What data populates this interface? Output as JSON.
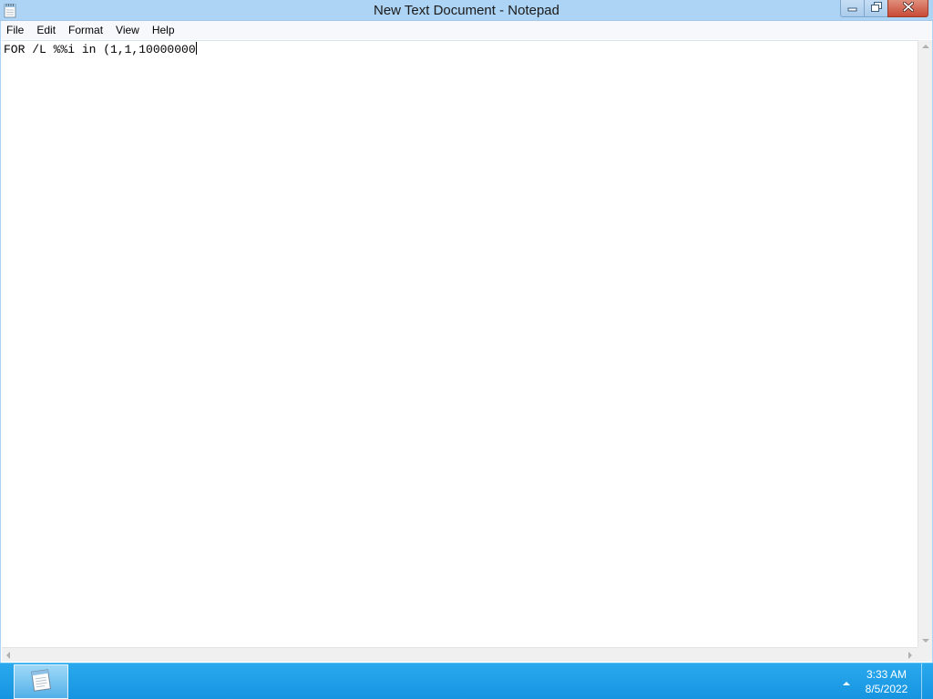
{
  "window": {
    "title": "New Text Document - Notepad",
    "icon": "notepad-icon",
    "controls": {
      "minimize_icon": "minimize-icon",
      "restore_icon": "restore-icon",
      "close_icon": "close-icon",
      "close_color": "#c74a35"
    }
  },
  "menu": {
    "items": [
      {
        "label": "File"
      },
      {
        "label": "Edit"
      },
      {
        "label": "Format"
      },
      {
        "label": "View"
      },
      {
        "label": "Help"
      }
    ]
  },
  "editor": {
    "content": "FOR /L %%i in (1,1,10000000"
  },
  "taskbar": {
    "app_icon": "notepad-icon",
    "tray_icon": "show-hidden-icons-icon",
    "clock": {
      "time": "3:33 AM",
      "date": "8/5/2022"
    },
    "color": "#1e9ee8"
  },
  "colors": {
    "titlebar": "#aed4f5",
    "menubar": "#f6f8fb"
  }
}
